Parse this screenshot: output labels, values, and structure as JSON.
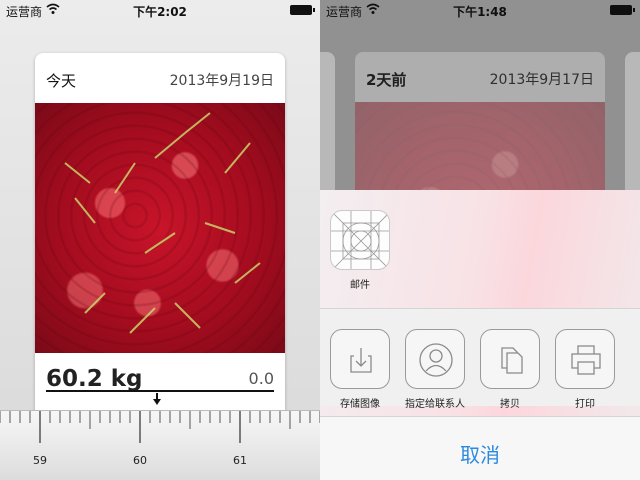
{
  "left": {
    "status": {
      "carrier": "运营商",
      "time": "下午2:02"
    },
    "card": {
      "day": "今天",
      "date": "2013年9月19日",
      "weight": "60.2 kg",
      "delta": "0.0"
    },
    "ruler": {
      "labels": [
        "59",
        "60",
        "61"
      ]
    }
  },
  "right": {
    "status": {
      "carrier": "运营商",
      "time": "下午1:48"
    },
    "card": {
      "day": "2天前",
      "date": "2013年9月17日"
    },
    "share_sheet": {
      "apps": [
        {
          "label": "邮件",
          "icon": "mail-app-icon"
        }
      ],
      "actions": [
        {
          "label": "存储图像",
          "icon": "save-image-icon"
        },
        {
          "label": "指定给联系人",
          "icon": "assign-contact-icon"
        },
        {
          "label": "拷贝",
          "icon": "copy-icon"
        },
        {
          "label": "打印",
          "icon": "print-icon"
        }
      ],
      "cancel": "取消"
    }
  },
  "colors": {
    "accent": "#2b8ae0",
    "cherry": "#b5102a"
  }
}
